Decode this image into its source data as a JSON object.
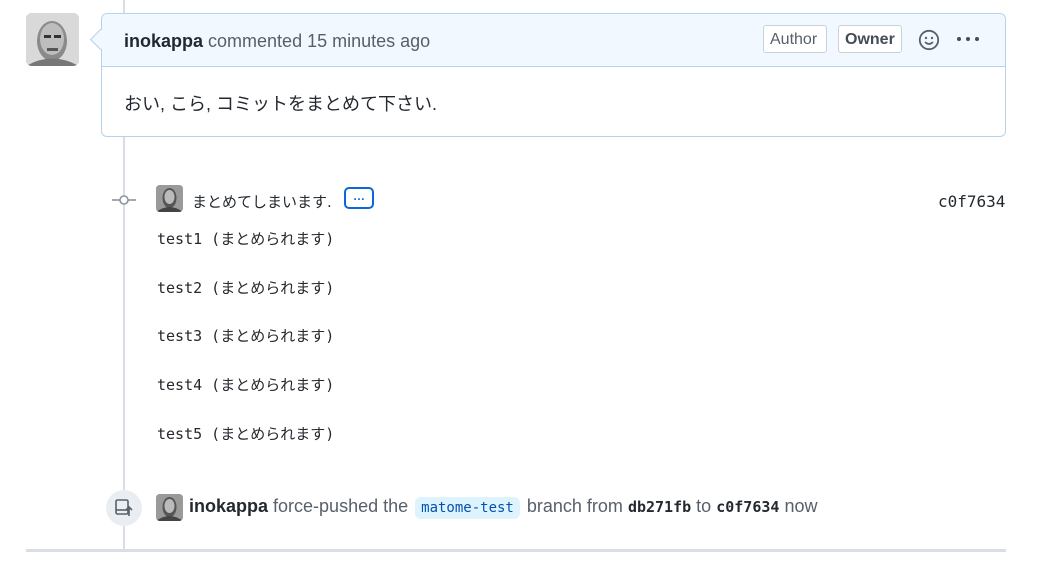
{
  "comment": {
    "author": "inokappa",
    "action": "commented 15 minutes ago",
    "badges": {
      "author": "Author",
      "owner": "Owner"
    },
    "body": "おい, こら, コミットをまとめて下さい."
  },
  "commit": {
    "title": "まとめてしまいます.",
    "expand_label": "…",
    "sha": "c0f7634",
    "lines": [
      "test1 (まとめられます)",
      "test2 (まとめられます)",
      "test3 (まとめられます)",
      "test4 (まとめられます)",
      "test5 (まとめられます)"
    ]
  },
  "force_push": {
    "actor": "inokappa",
    "text_before_branch": "force-pushed the",
    "branch": "matome-test",
    "text_from": "branch from",
    "from_sha": "db271fb",
    "text_to": "to",
    "to_sha": "c0f7634",
    "time": "now"
  },
  "icons": {
    "emoji": "smiley-icon",
    "more": "kebab-horizontal-icon",
    "commit": "git-commit-icon",
    "force_push": "repo-push-icon"
  },
  "colors": {
    "header_bg": "#f1f8ff",
    "header_border": "#b6d2ec",
    "link_blue": "#0969da",
    "branch_bg": "#ddf4ff"
  }
}
